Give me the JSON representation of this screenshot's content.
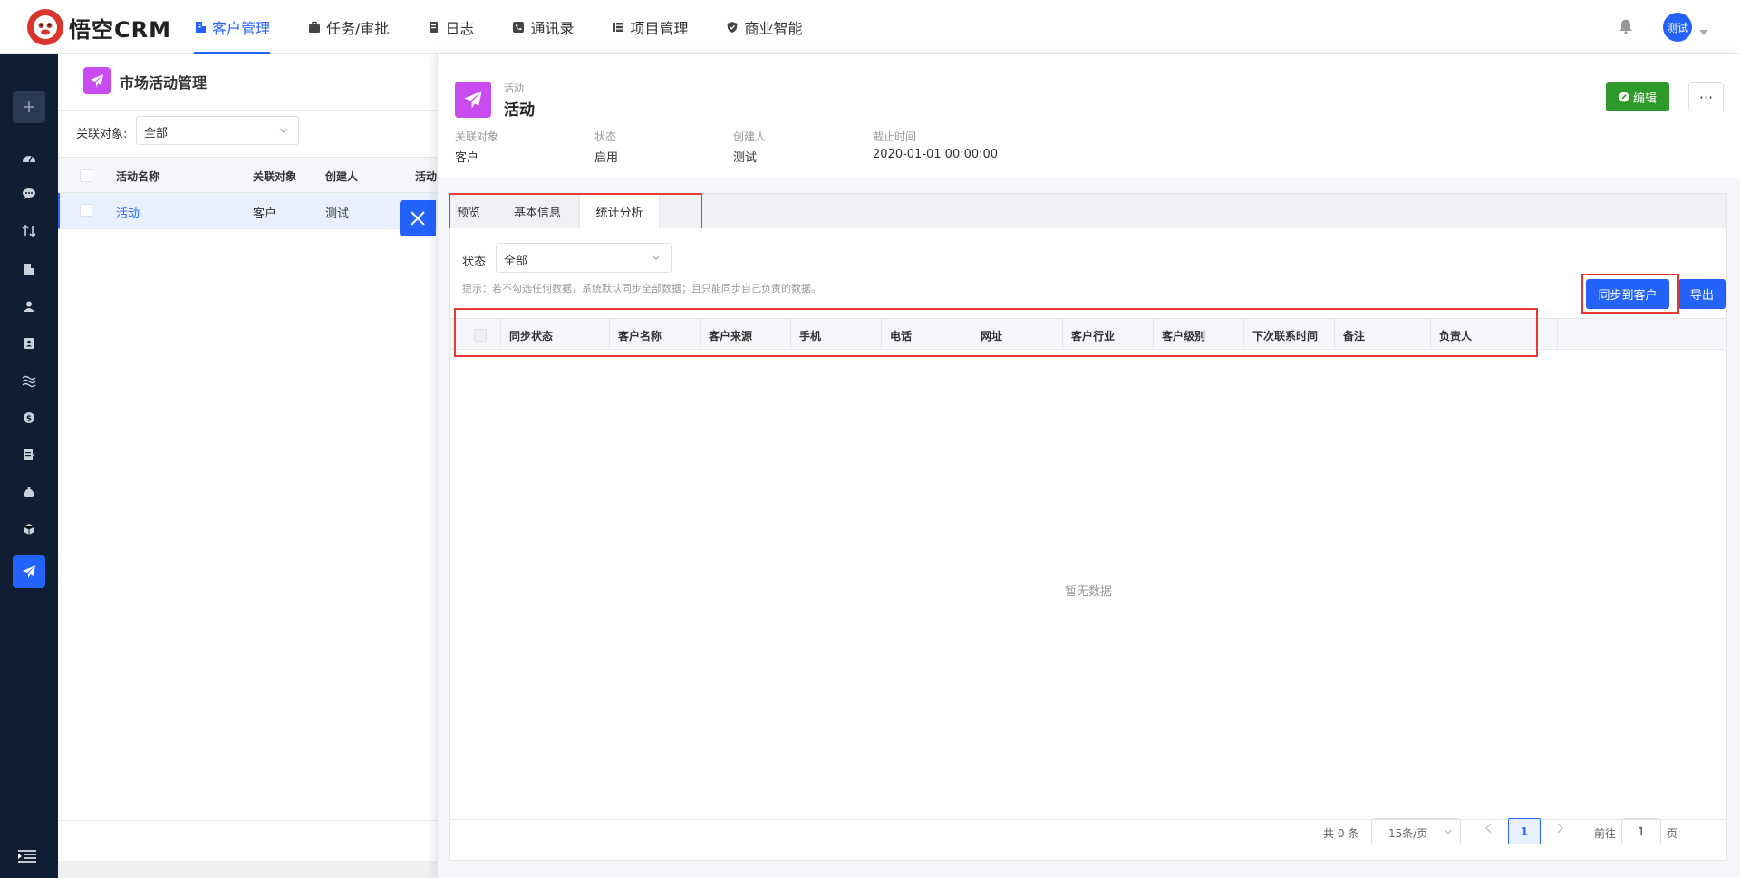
{
  "header": {
    "logo_text": "悟空CRM",
    "nav": [
      {
        "label": "客户管理",
        "icon": "building-icon",
        "active": true
      },
      {
        "label": "任务/审批",
        "icon": "briefcase-icon",
        "active": false
      },
      {
        "label": "日志",
        "icon": "notebook-icon",
        "active": false
      },
      {
        "label": "通讯录",
        "icon": "phone-book-icon",
        "active": false
      },
      {
        "label": "项目管理",
        "icon": "list-icon",
        "active": false
      },
      {
        "label": "商业智能",
        "icon": "shield-check-icon",
        "active": false
      }
    ],
    "avatar_text": "测试",
    "accent": "#2362fb"
  },
  "list_page": {
    "title": "市场活动管理",
    "filter_label": "关联对象:",
    "filter_value": "全部",
    "columns": [
      "活动名称",
      "关联对象",
      "创建人",
      "活动"
    ],
    "rows": [
      {
        "name": "活动",
        "related": "客户",
        "creator": "测试"
      }
    ]
  },
  "detail": {
    "type_label": "活动",
    "title": "活动",
    "edit_label": "编辑",
    "more_label": "···",
    "meta": [
      {
        "key": "关联对象",
        "value": "客户"
      },
      {
        "key": "状态",
        "value": "启用"
      },
      {
        "key": "创建人",
        "value": "测试"
      },
      {
        "key": "截止时间",
        "value": "2020-01-01 00:00:00"
      }
    ],
    "tabs": [
      "预览",
      "基本信息",
      "统计分析"
    ],
    "active_tab": "统计分析",
    "state_label": "状态",
    "state_value": "全部",
    "hint": "提示：若不勾选任何数据，系统默认同步全部数据；且只能同步自己负责的数据。",
    "sync_label": "同步到客户",
    "export_label": "导出",
    "columns": [
      "同步状态",
      "客户名称",
      "客户来源",
      "手机",
      "电话",
      "网址",
      "客户行业",
      "客户级别",
      "下次联系时间",
      "备注",
      "负责人"
    ],
    "empty_text": "暂无数据",
    "pager": {
      "total": "共 0 条",
      "page_size": "15条/页",
      "current": "1",
      "goto_label": "前往",
      "goto_value": "1",
      "unit": "页"
    }
  }
}
